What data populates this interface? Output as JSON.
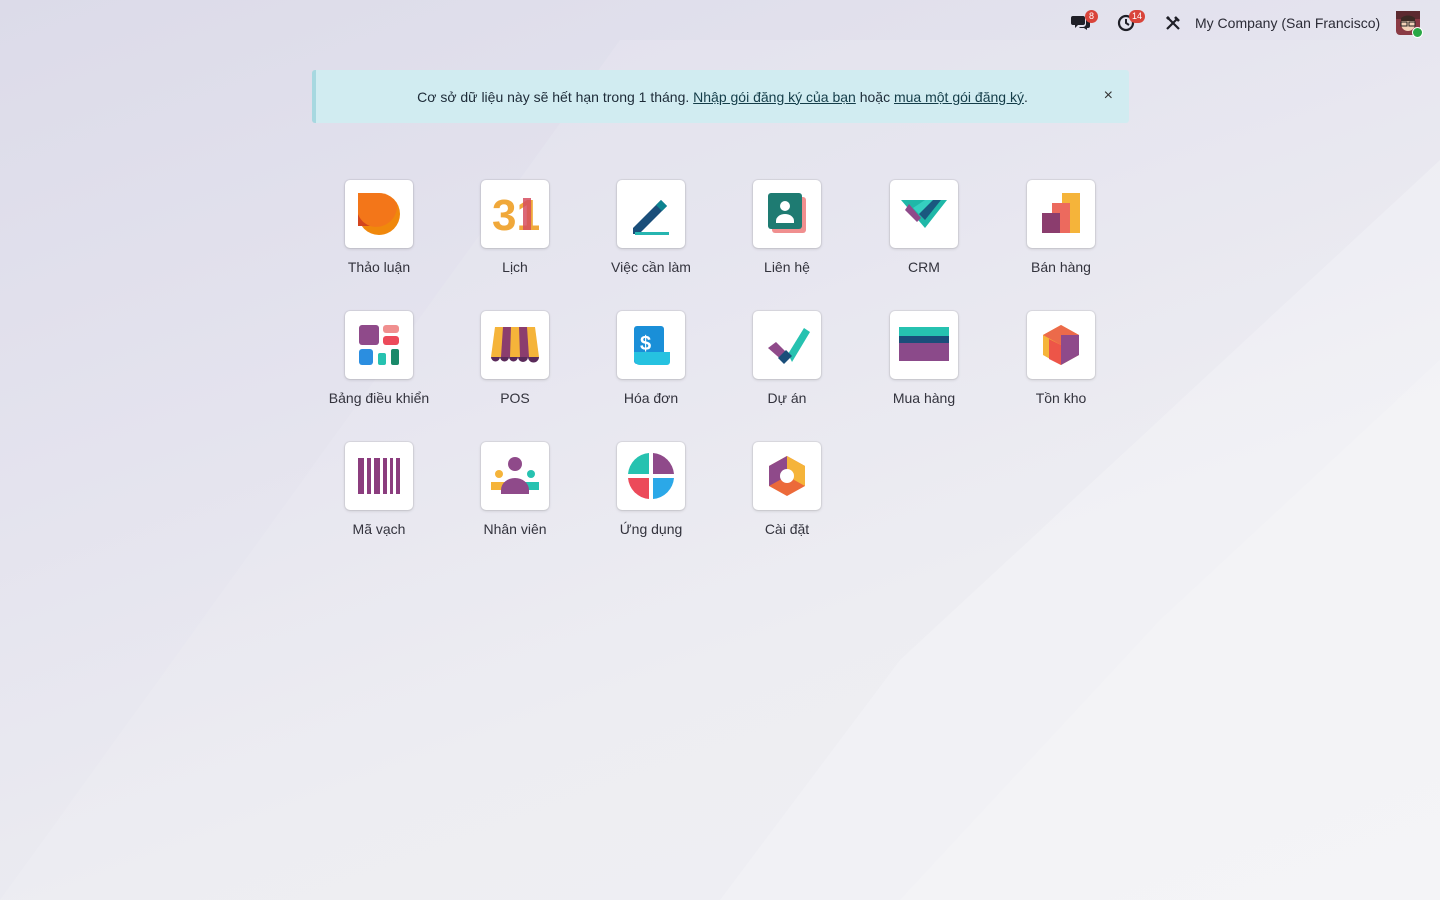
{
  "topbar": {
    "messages_badge": "8",
    "activities_badge": "14",
    "company": "My Company (San Francisco)"
  },
  "alert": {
    "text": "Cơ sở dữ liệu này sẽ hết hạn trong 1 tháng.",
    "link1": "Nhập gói đăng ký của bạn",
    "middle": "hoặc",
    "link2": "mua một gói đăng ký",
    "end": ".",
    "close": "×"
  },
  "apps": [
    {
      "label": "Thảo luận",
      "icon": "discuss-icon"
    },
    {
      "label": "Lịch",
      "icon": "calendar-icon"
    },
    {
      "label": "Việc cần làm",
      "icon": "todo-icon"
    },
    {
      "label": "Liên hệ",
      "icon": "contacts-icon"
    },
    {
      "label": "CRM",
      "icon": "crm-icon"
    },
    {
      "label": "Bán hàng",
      "icon": "sales-icon"
    },
    {
      "label": "Bảng điều khiển",
      "icon": "dashboard-icon"
    },
    {
      "label": "POS",
      "icon": "pos-icon"
    },
    {
      "label": "Hóa đơn",
      "icon": "invoice-icon"
    },
    {
      "label": "Dự án",
      "icon": "project-icon"
    },
    {
      "label": "Mua hàng",
      "icon": "purchase-icon"
    },
    {
      "label": "Tồn kho",
      "icon": "inventory-icon"
    },
    {
      "label": "Mã vạch",
      "icon": "barcode-icon"
    },
    {
      "label": "Nhân viên",
      "icon": "employees-icon"
    },
    {
      "label": "Ứng dụng",
      "icon": "apps-icon"
    },
    {
      "label": "Cài đặt",
      "icon": "settings-icon"
    }
  ],
  "calendar_icon_text": "31"
}
